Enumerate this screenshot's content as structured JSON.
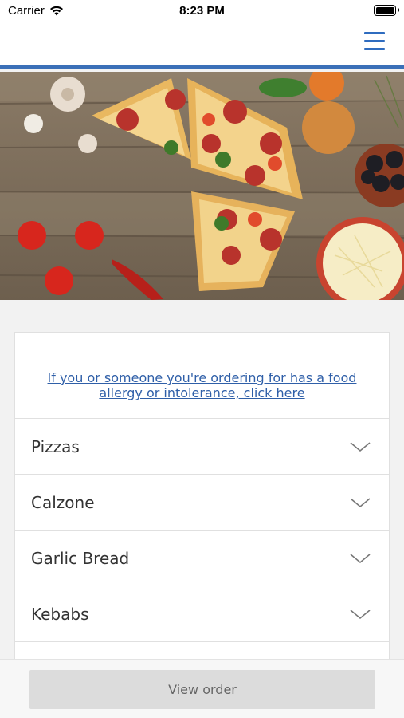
{
  "status": {
    "carrier": "Carrier",
    "time": "8:23 PM"
  },
  "header": {
    "menu_icon": "hamburger-menu-icon"
  },
  "hero": {
    "image": "pizza-ingredients-photo"
  },
  "allergy_link": "If you or someone you're ordering for has a food allergy or intolerance, click here",
  "categories": [
    {
      "label": "Pizzas"
    },
    {
      "label": "Calzone"
    },
    {
      "label": "Garlic Bread"
    },
    {
      "label": "Kebabs"
    }
  ],
  "footer": {
    "view_order_label": "View order"
  },
  "colors": {
    "accent": "#3b70b8",
    "link": "#2f5fa8"
  }
}
